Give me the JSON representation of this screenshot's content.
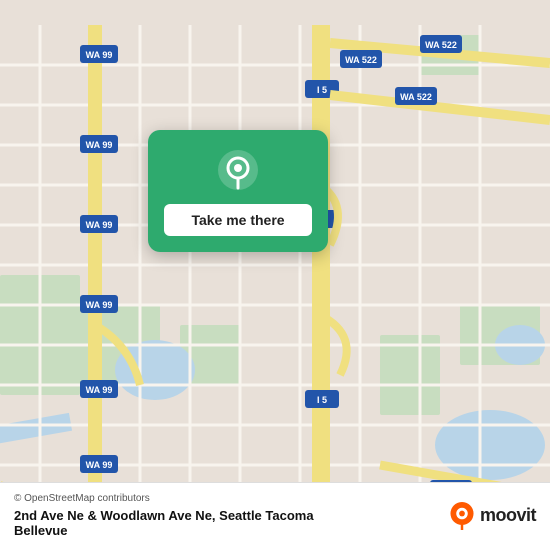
{
  "map": {
    "background_color": "#e8e0d8",
    "road_color_primary": "#f5f0e8",
    "road_color_highway": "#f0e080",
    "road_color_freeway": "#f0e080",
    "water_color": "#b8d4e8",
    "green_color": "#c8ddc0"
  },
  "popup": {
    "background_color": "#2eaa6e",
    "button_label": "Take me there",
    "pin_color": "white"
  },
  "bottom_bar": {
    "osm_credit": "© OpenStreetMap contributors",
    "location_text": "2nd Ave Ne & Woodlawn Ave Ne, Seattle Tacoma",
    "location_subtext": "Bellevue",
    "moovit_label": "moovit"
  }
}
